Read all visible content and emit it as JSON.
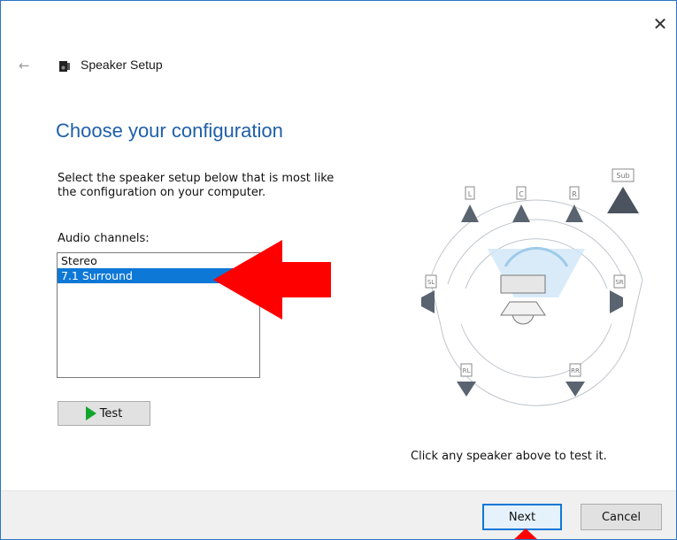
{
  "window": {
    "title": "Speaker Setup",
    "back_icon": "back-arrow-icon",
    "close_icon": "close-icon",
    "close_glyph": "✕"
  },
  "page": {
    "heading": "Choose your configuration",
    "description": "Select the speaker setup below that is most like\nthe configuration on your computer.",
    "channels_label": "Audio channels:",
    "channels": [
      {
        "label": "Stereo",
        "selected": false
      },
      {
        "label": "7.1 Surround",
        "selected": true
      }
    ],
    "test_button": "Test",
    "hint": "Click any speaker above to test it."
  },
  "speaker_diagram": {
    "labels": {
      "front_left": "L",
      "center": "C",
      "front_right": "R",
      "sub": "Sub",
      "side_left": "SL",
      "side_right": "SR",
      "rear_left": "RL",
      "rear_right": "RR"
    }
  },
  "footer": {
    "next_button": "Next",
    "cancel_button": "Cancel"
  },
  "colors": {
    "accent": "#0e78d6",
    "heading": "#1f5fa8",
    "annotation_arrow": "#ff0000"
  }
}
